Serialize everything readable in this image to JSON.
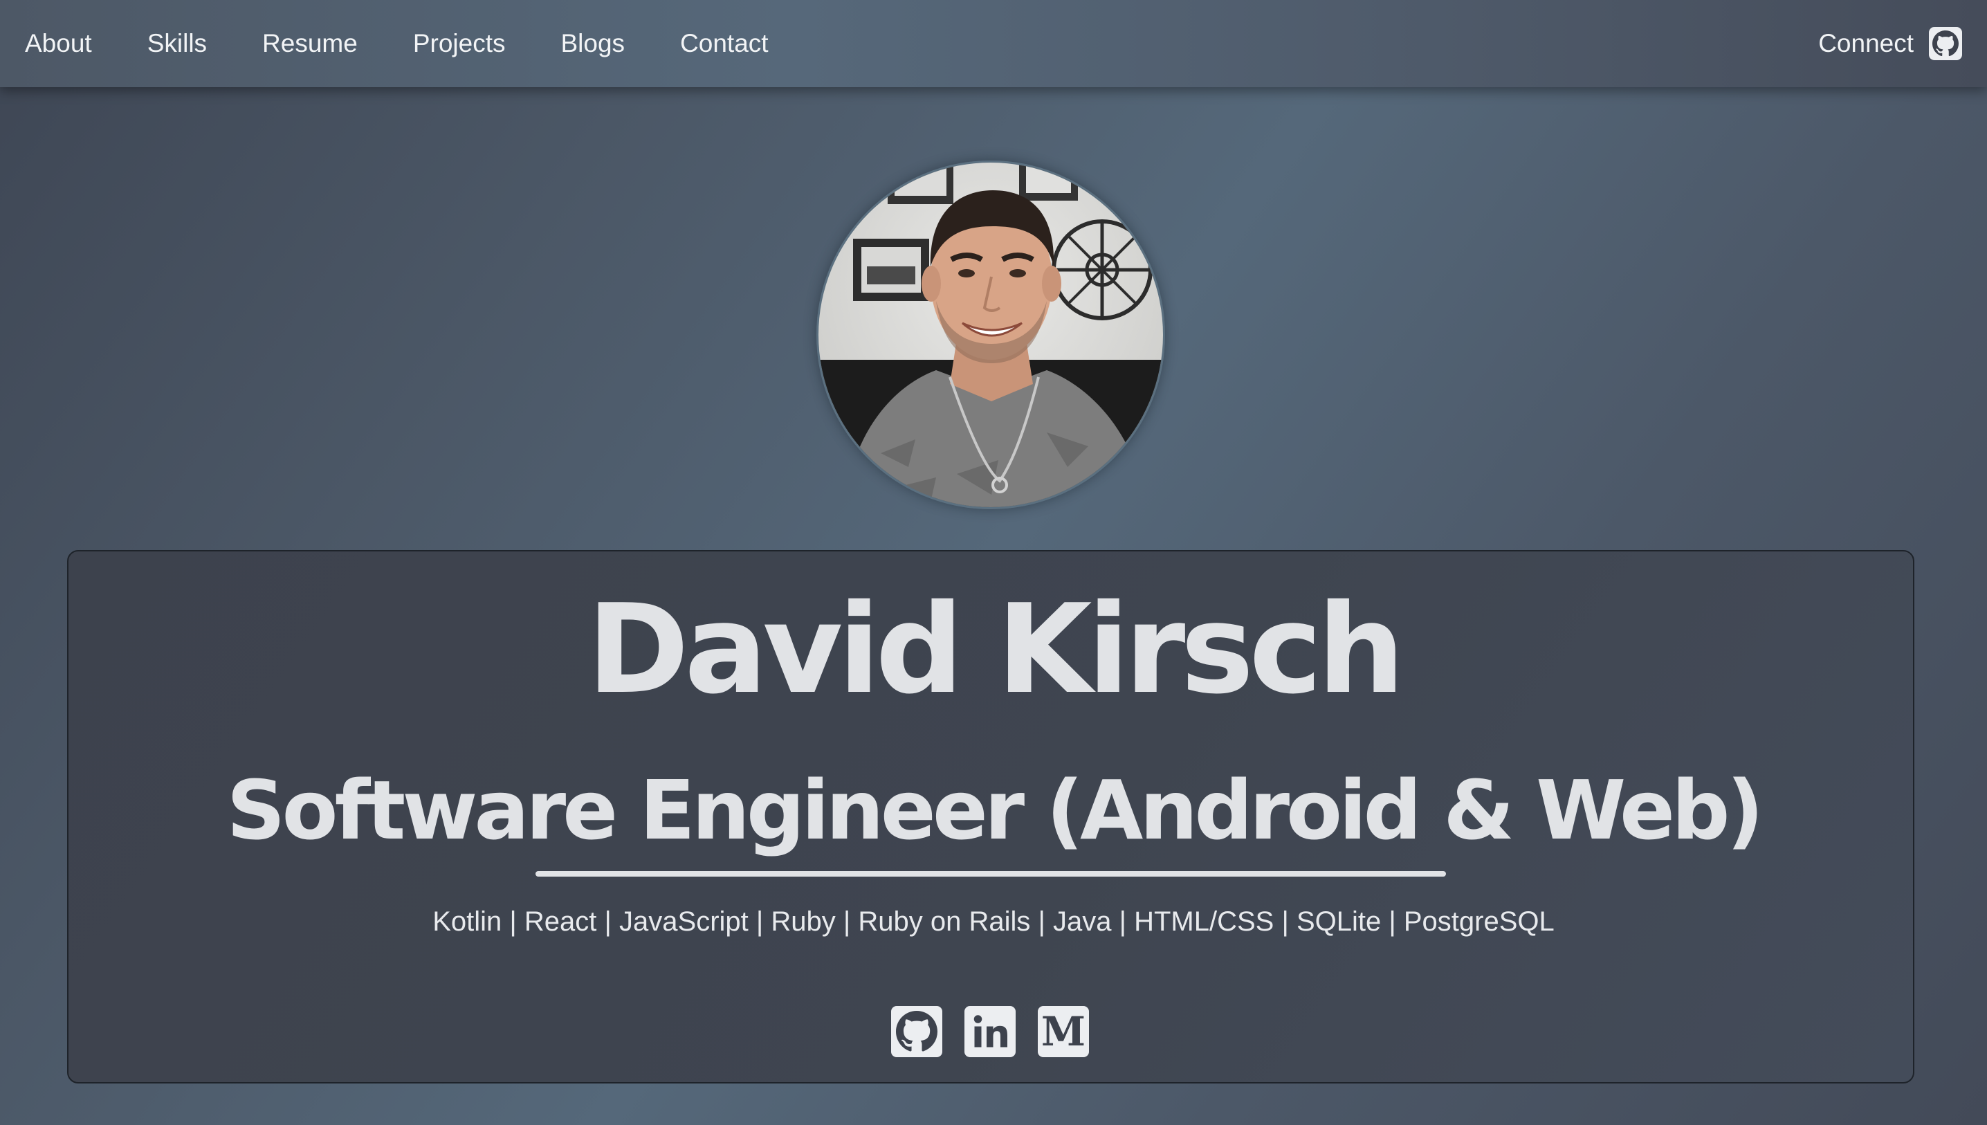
{
  "nav": {
    "links": [
      "About",
      "Skills",
      "Resume",
      "Projects",
      "Blogs",
      "Contact"
    ],
    "connect_label": "Connect",
    "connect_icon": "github-icon"
  },
  "profile": {
    "avatar_alt": "profile-photo"
  },
  "hero": {
    "name": "David Kirsch",
    "title": "Software Engineer (Android & Web)",
    "skills": "Kotlin | React | JavaScript | Ruby | Ruby on Rails | Java | HTML/CSS | SQLite | PostgreSQL"
  },
  "socials": [
    {
      "icon": "github-icon"
    },
    {
      "icon": "linkedin-icon"
    },
    {
      "icon": "medium-icon",
      "glyph": "M"
    }
  ],
  "colors": {
    "nav_text": "#f2f4f6",
    "heading_text": "#e1e3e6",
    "card_background": "#3f4550",
    "icon_tile": "#eceef1"
  }
}
